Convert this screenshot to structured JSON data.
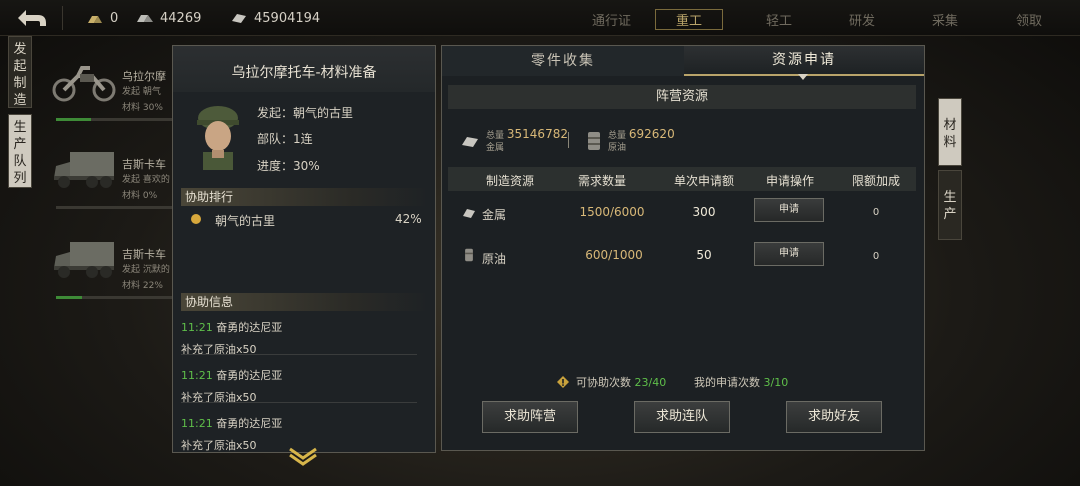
{
  "topbar": {
    "resources": [
      {
        "icon": "gold-bars-icon",
        "value": "0"
      },
      {
        "icon": "steel-ingots-icon",
        "value": "44269"
      },
      {
        "icon": "metal-plate-icon",
        "value": "45904194"
      }
    ],
    "nav": [
      "通行证",
      "重工",
      "轻工",
      "研发",
      "采集",
      "领取"
    ],
    "nav_active": "重工"
  },
  "left_tabs": [
    "发起制造",
    "生产队列"
  ],
  "list": [
    {
      "title": "乌拉尔摩",
      "line1": "发起  朝气",
      "line2": "材料  30%",
      "progress": 0.3,
      "icon": "motorcycle-icon"
    },
    {
      "title": "吉斯卡车",
      "line1": "发起  喜欢的",
      "line2": "材料  0%",
      "progress": 0.0,
      "icon": "truck-icon"
    },
    {
      "title": "吉斯卡车",
      "line1": "发起  沉默的",
      "line2": "材料  22%",
      "progress": 0.22,
      "icon": "truck-icon"
    }
  ],
  "popup": {
    "title": "乌拉尔摩托车-材料准备",
    "initiator_label": "发起：",
    "initiator": "朝气的古里",
    "unit_label": "部队：",
    "unit": "1连",
    "progress_label": "进度：",
    "progress": "30%",
    "rank_header": "协助排行",
    "rank": [
      {
        "name": "朝气的古里",
        "percent": "42%"
      }
    ],
    "info_header": "协助信息",
    "feed": [
      {
        "time": "11:21",
        "name": "奋勇的达尼亚",
        "action": "补充了原油x50"
      },
      {
        "time": "11:21",
        "name": "奋勇的达尼亚",
        "action": "补充了原油x50"
      },
      {
        "time": "11:21",
        "name": "奋勇的达尼亚",
        "action": "补充了原油x50"
      }
    ]
  },
  "panel": {
    "tab_parts": "零件收集",
    "tab_resources": "资源申请",
    "camp_header": "阵营资源",
    "totals": [
      {
        "label": "总量",
        "value": "35146782",
        "name": "金属",
        "icon": "metal-icon"
      },
      {
        "label": "总量",
        "value": "692620",
        "name": "原油",
        "icon": "oil-barrel-icon"
      }
    ],
    "columns": [
      "制造资源",
      "需求数量",
      "单次申请额",
      "申请操作",
      "限额加成"
    ],
    "rows": [
      {
        "name": "金属",
        "icon": "metal-icon",
        "need": "1500/6000",
        "per": "300",
        "btn": "申请",
        "bonus": "0"
      },
      {
        "name": "原油",
        "icon": "oil-barrel-icon",
        "need": "600/1000",
        "per": "50",
        "btn": "申请",
        "bonus": "0"
      }
    ],
    "assist_label": "可协助次数",
    "assist_value": "23/40",
    "my_label": "我的申请次数",
    "my_value": "3/10",
    "buttons": [
      "求助阵营",
      "求助连队",
      "求助好友"
    ]
  },
  "right_tabs": [
    "材料",
    "生产"
  ],
  "colors": {
    "accent": "#b9a46a",
    "green": "#5fbf4a",
    "gold": "#d8b878"
  }
}
